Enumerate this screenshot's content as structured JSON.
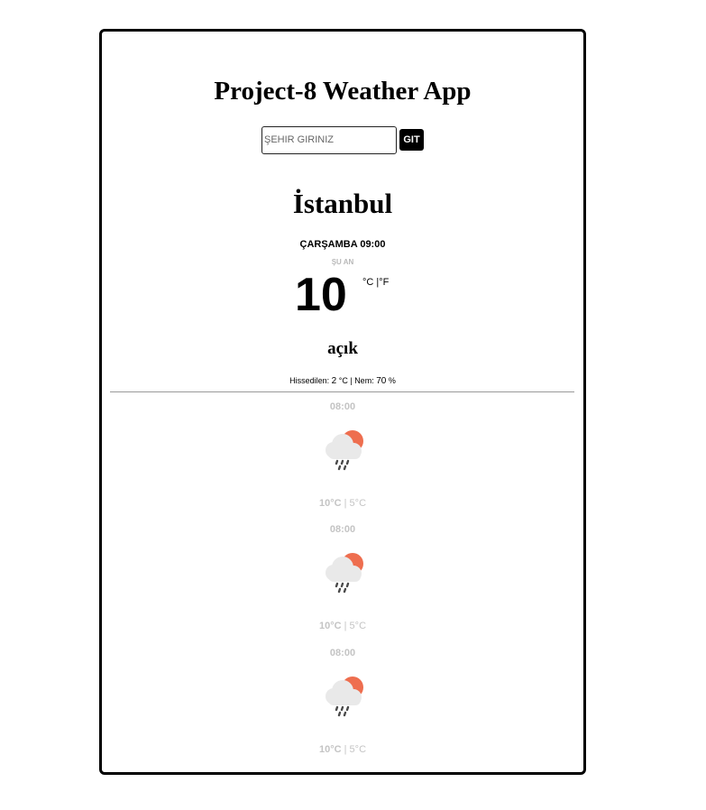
{
  "app": {
    "title": "Project-8 Weather App"
  },
  "search": {
    "placeholder": "ŞEHIR GIRINIZ",
    "value": "",
    "button_label": "GIT"
  },
  "current": {
    "city": "İstanbul",
    "day_time": "ÇARŞAMBA 09:00",
    "now_label": "ŞU AN",
    "temperature": "10",
    "units": "°C |°F",
    "condition": "açık",
    "feels_label": "Hissedilen:",
    "feels_value": "2",
    "feels_unit": "°C | Nem:",
    "humidity_value": "70",
    "humidity_unit": "%"
  },
  "forecast": [
    {
      "time": "08:00",
      "icon": "rain-cloud-sun-icon",
      "high": "10°C",
      "separator": "|",
      "low": "5°C"
    },
    {
      "time": "08:00",
      "icon": "rain-cloud-sun-icon",
      "high": "10°C",
      "separator": "|",
      "low": "5°C"
    },
    {
      "time": "08:00",
      "icon": "rain-cloud-sun-icon",
      "high": "10°C",
      "separator": "|",
      "low": "5°C"
    }
  ],
  "colors": {
    "border": "#000000",
    "sun": "#ee6e4f",
    "cloud": "#e9e9e9",
    "rain": "#4a4a4a",
    "muted_text": "#c4c4c4"
  }
}
